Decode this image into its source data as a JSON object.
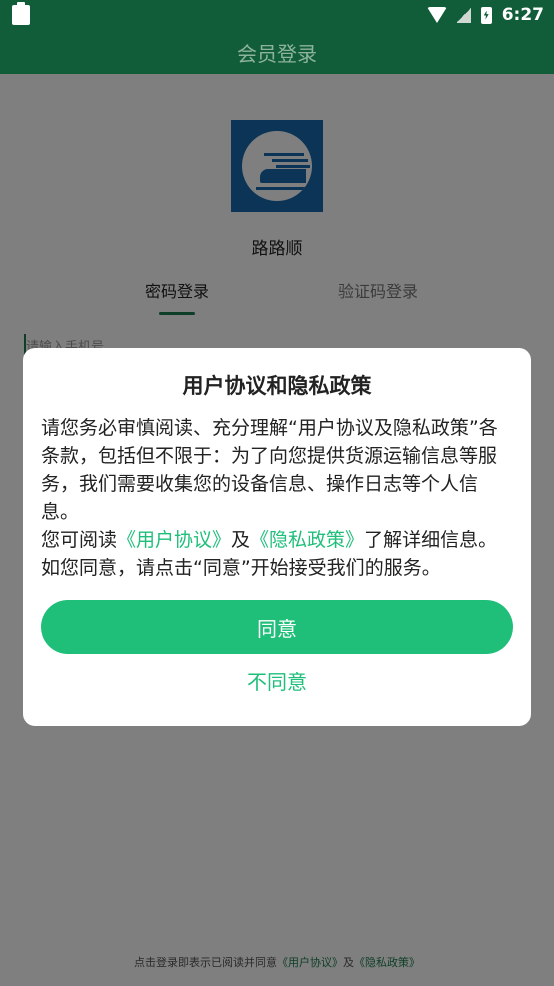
{
  "status_bar": {
    "time": "6:27",
    "icons": [
      "clipboard-icon",
      "wifi-icon",
      "signal-icon",
      "battery-icon"
    ]
  },
  "app_bar": {
    "title": "会员登录"
  },
  "app": {
    "name": "路路顺"
  },
  "tabs": [
    {
      "label": "密码登录",
      "active": true
    },
    {
      "label": "验证码登录",
      "active": false
    }
  ],
  "form": {
    "phone_placeholder": "请输入手机号"
  },
  "footer": {
    "prefix": "点击登录即表示已阅读并同意",
    "link1": "《用户协议》",
    "middle": "及",
    "link2": "《隐私政策》"
  },
  "dialog": {
    "title": "用户协议和隐私政策",
    "para1": "请您务必审慎阅读、充分理解“用户协议及隐私政策”各条款，包括但不限于：为了向您提供货源运输信息等服务，我们需要收集您的设备信息、操作日志等个人信息。",
    "para2_prefix": "您可阅读",
    "para2_link1": "《用户协议》",
    "para2_and": "及",
    "para2_link2": "《隐私政策》",
    "para2_suffix": "了解详细信息。如您同意，请点击“同意”开始接受我们的服务。",
    "agree_label": "同意",
    "disagree_label": "不同意"
  },
  "colors": {
    "primary_dark": "#115d39",
    "accent": "#1fbf7a",
    "logo_blue": "#1769ad"
  }
}
